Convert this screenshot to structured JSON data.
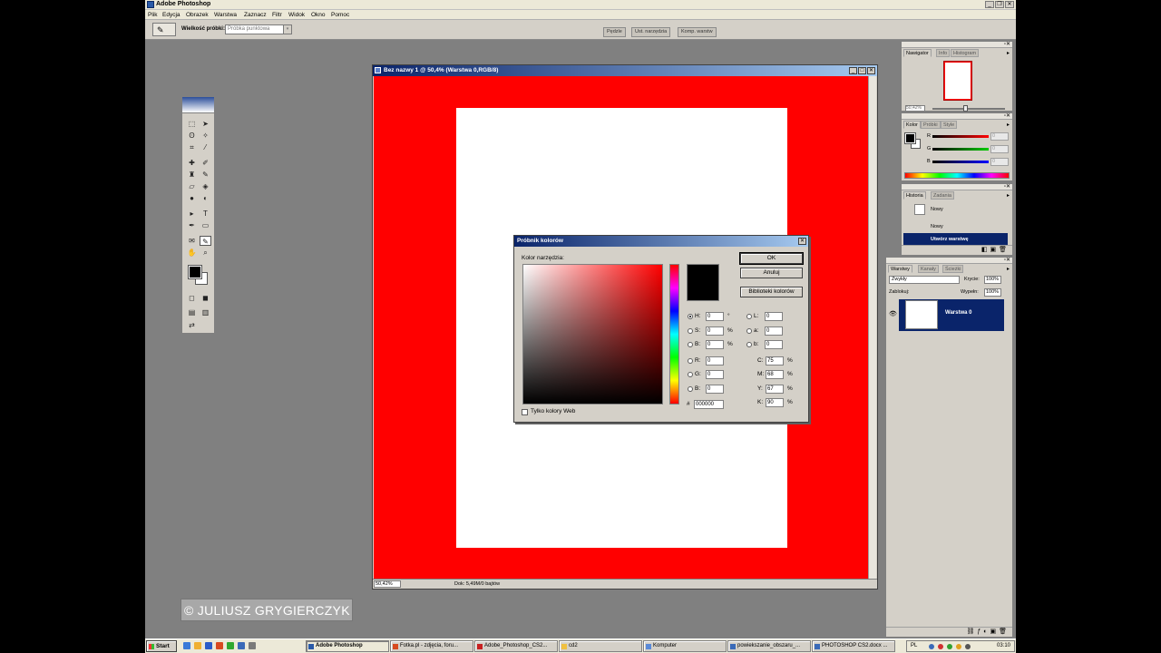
{
  "app": {
    "title": "Adobe Photoshop"
  },
  "menu": [
    "Plik",
    "Edycja",
    "Obrazek",
    "Warstwa",
    "Zaznacz",
    "Filtr",
    "Widok",
    "Okno",
    "Pomoc"
  ],
  "options": {
    "sample_label": "Wielkość próbki:",
    "sample_value": "Próbka punktowa",
    "well_tabs": [
      "Pędzle",
      "Ust. narzędzia",
      "Komp. warstw"
    ]
  },
  "document": {
    "title": "Bez nazwy 1 @ 50,4% (Warstwa 0,RGB/8)",
    "zoom": "50,42%",
    "status": "Dok: 5,49M/0 bajtów",
    "canvas_color": "#ff0000",
    "page_color": "#ffffff"
  },
  "picker": {
    "title": "Próbnik kolorów",
    "label": "Kolor narzędzia:",
    "ok": "OK",
    "cancel": "Anuluj",
    "libraries": "Biblioteki kolorów",
    "fields_left": [
      {
        "label": "H:",
        "value": "0",
        "unit": "°",
        "checked": true
      },
      {
        "label": "S:",
        "value": "0",
        "unit": "%",
        "checked": false
      },
      {
        "label": "B:",
        "value": "0",
        "unit": "%",
        "checked": false
      },
      {
        "label": "R:",
        "value": "0",
        "unit": "",
        "checked": false
      },
      {
        "label": "G:",
        "value": "0",
        "unit": "",
        "checked": false
      },
      {
        "label": "B:",
        "value": "0",
        "unit": "",
        "checked": false
      }
    ],
    "fields_lab": [
      {
        "label": "L:",
        "value": "0"
      },
      {
        "label": "a:",
        "value": "0"
      },
      {
        "label": "b:",
        "value": "0"
      }
    ],
    "fields_cmyk": [
      {
        "label": "C:",
        "value": "75",
        "unit": "%"
      },
      {
        "label": "M:",
        "value": "68",
        "unit": "%"
      },
      {
        "label": "Y:",
        "value": "67",
        "unit": "%"
      },
      {
        "label": "K:",
        "value": "90",
        "unit": "%"
      }
    ],
    "hex_label": "#",
    "hex": "000000",
    "web_only": "Tylko kolory Web"
  },
  "navigator": {
    "tabs": [
      "Nawigator",
      "Info",
      "Histogram"
    ],
    "zoom": "50,42%"
  },
  "color_panel": {
    "tabs": [
      "Kolor",
      "Próbki",
      "Style"
    ],
    "rows": [
      {
        "label": "R",
        "value": "0"
      },
      {
        "label": "G",
        "value": "0"
      },
      {
        "label": "B",
        "value": "0"
      }
    ]
  },
  "history": {
    "tabs": [
      "Historia",
      "Zadania"
    ],
    "items": [
      "Nowy",
      "Nowy",
      "Utwórz warstwę"
    ]
  },
  "layers": {
    "tabs": [
      "Warstwy",
      "Kanały",
      "Ścieżki"
    ],
    "mode": "Zwykły",
    "opacity_label": "Krycie:",
    "opacity": "100%",
    "lock_label": "Zablokuj:",
    "fill_label": "Wypełn:",
    "fill": "100%",
    "layer_name": "Warstwa 0"
  },
  "watermark": "© JULIUSZ GRYGIERCZYK",
  "taskbar": {
    "start": "Start",
    "tasks": [
      "Adobe Photoshop",
      "Fotka.pl - zdjęcia, foru...",
      "Adobe_Photoshop_CS2...",
      "cd2",
      "Komputer",
      "powiekszanie_obszaru_...",
      "PHOTOSHOP CS2.docx ..."
    ],
    "lang": "PL",
    "clock": "03:10"
  }
}
